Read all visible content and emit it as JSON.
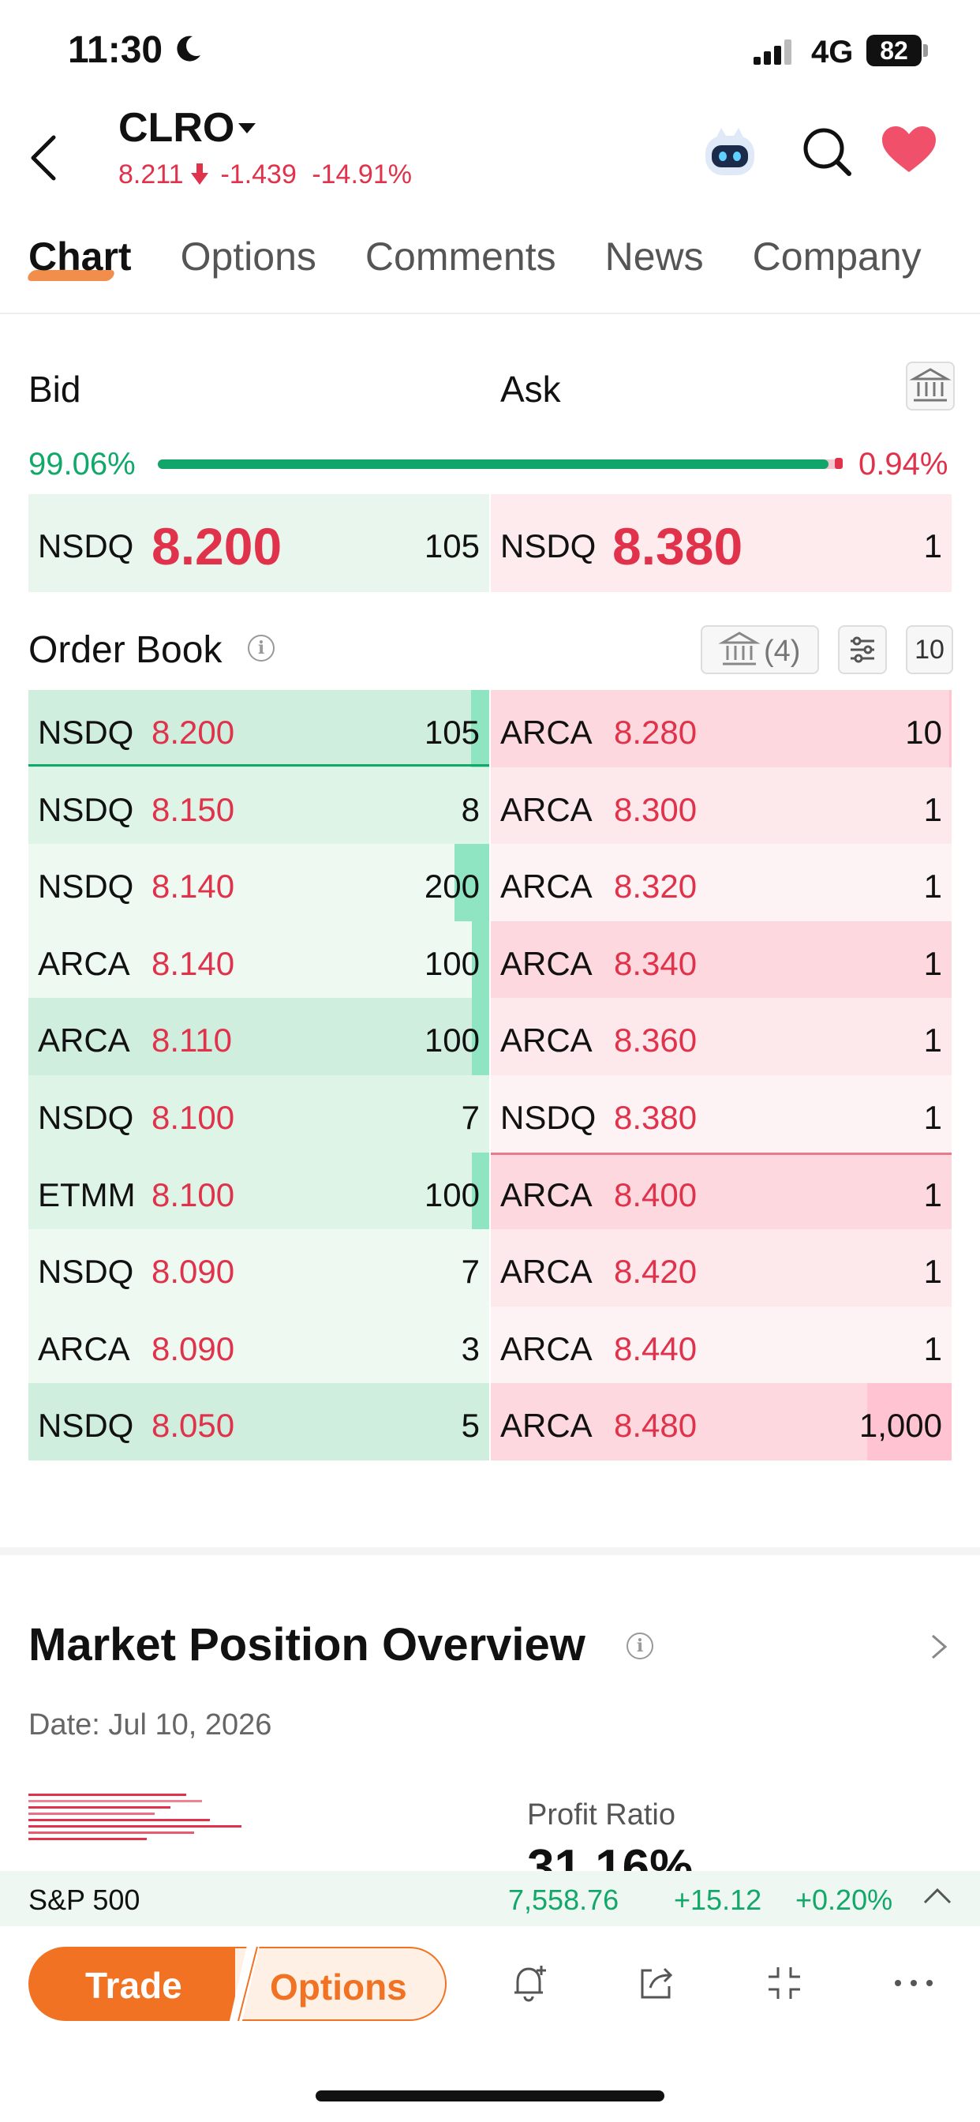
{
  "status": {
    "time": "11:30",
    "network": "4G",
    "battery": "82"
  },
  "header": {
    "ticker": "CLRO",
    "price": "8.211",
    "change": "-1.439",
    "change_pct": "-14.91%"
  },
  "tabs": [
    {
      "label": "Chart",
      "active": true
    },
    {
      "label": "Options"
    },
    {
      "label": "Comments"
    },
    {
      "label": "News"
    },
    {
      "label": "Company"
    }
  ],
  "bidask": {
    "bid_label": "Bid",
    "ask_label": "Ask",
    "bid_pct": "99.06%",
    "ask_pct": "0.94%",
    "bid_fraction": 0.9906,
    "best_bid": {
      "exchange": "NSDQ",
      "price": "8.200",
      "size": "105"
    },
    "best_ask": {
      "exchange": "NSDQ",
      "price": "8.380",
      "size": "1"
    }
  },
  "order_book": {
    "title": "Order Book",
    "exchanges_count": "(4)",
    "depth": "10",
    "rows": [
      {
        "bid": {
          "ex": "NSDQ",
          "px": "8.200",
          "sz": "105",
          "level": 0.04
        },
        "ask": {
          "ex": "ARCA",
          "px": "8.280",
          "sz": "10",
          "level": 0.005
        }
      },
      {
        "bid": {
          "ex": "NSDQ",
          "px": "8.150",
          "sz": "8",
          "level": 0
        },
        "ask": {
          "ex": "ARCA",
          "px": "8.300",
          "sz": "1",
          "level": 0
        }
      },
      {
        "bid": {
          "ex": "NSDQ",
          "px": "8.140",
          "sz": "200",
          "level": 0.076
        },
        "ask": {
          "ex": "ARCA",
          "px": "8.320",
          "sz": "1",
          "level": 0
        }
      },
      {
        "bid": {
          "ex": "ARCA",
          "px": "8.140",
          "sz": "100",
          "level": 0.038
        },
        "ask": {
          "ex": "ARCA",
          "px": "8.340",
          "sz": "1",
          "level": 0
        }
      },
      {
        "bid": {
          "ex": "ARCA",
          "px": "8.110",
          "sz": "100",
          "level": 0.038
        },
        "ask": {
          "ex": "ARCA",
          "px": "8.360",
          "sz": "1",
          "level": 0
        }
      },
      {
        "bid": {
          "ex": "NSDQ",
          "px": "8.100",
          "sz": "7",
          "level": 0
        },
        "ask": {
          "ex": "NSDQ",
          "px": "8.380",
          "sz": "1",
          "level": 0
        }
      },
      {
        "bid": {
          "ex": "ETMM",
          "px": "8.100",
          "sz": "100",
          "level": 0.038
        },
        "ask": {
          "ex": "ARCA",
          "px": "8.400",
          "sz": "1",
          "level": 0
        }
      },
      {
        "bid": {
          "ex": "NSDQ",
          "px": "8.090",
          "sz": "7",
          "level": 0
        },
        "ask": {
          "ex": "ARCA",
          "px": "8.420",
          "sz": "1",
          "level": 0
        }
      },
      {
        "bid": {
          "ex": "ARCA",
          "px": "8.090",
          "sz": "3",
          "level": 0
        },
        "ask": {
          "ex": "ARCA",
          "px": "8.440",
          "sz": "1",
          "level": 0
        }
      },
      {
        "bid": {
          "ex": "NSDQ",
          "px": "8.050",
          "sz": "5",
          "level": 0
        },
        "ask": {
          "ex": "ARCA",
          "px": "8.480",
          "sz": "1,000",
          "level": 0.183
        }
      }
    ]
  },
  "market_position": {
    "title": "Market Position Overview",
    "date": "Date: Jul 10, 2026",
    "profit_ratio_label": "Profit Ratio",
    "profit_ratio_value": "31.16%"
  },
  "index_bar": {
    "name": "S&P 500",
    "value": "7,558.76",
    "change": "+15.12",
    "change_pct": "+0.20%"
  },
  "toolbar": {
    "trade": "Trade",
    "options": "Options"
  },
  "colors": {
    "up": "#11a86a",
    "down": "#e0324b",
    "accent": "#f07222"
  }
}
